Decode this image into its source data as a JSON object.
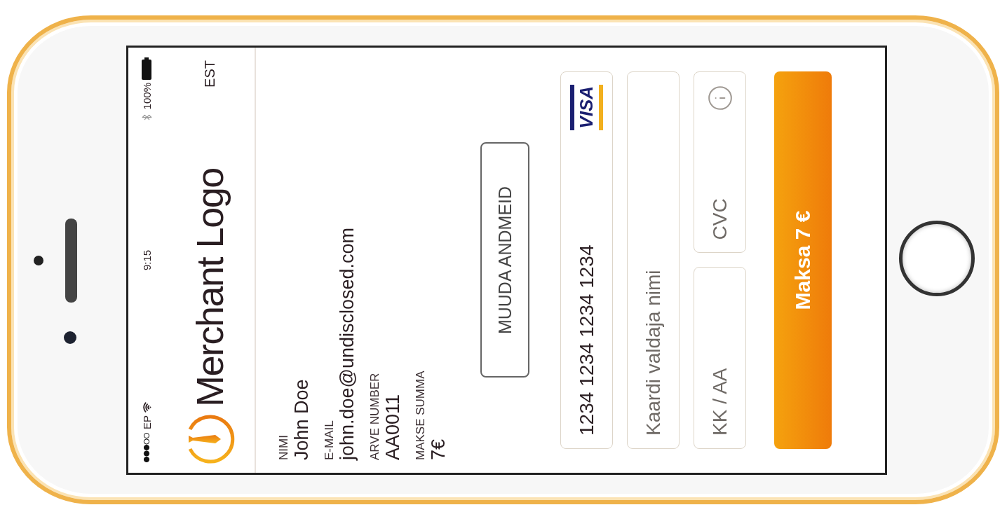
{
  "status_bar": {
    "carrier": "EP",
    "time": "9:15",
    "battery": "100%"
  },
  "header": {
    "logo_text": "Merchant Logo",
    "language": "EST"
  },
  "details": [
    {
      "label": "NIMI",
      "value": "John Doe"
    },
    {
      "label": "E-MAIL",
      "value": "john.doe@undisclosed.com"
    },
    {
      "label": "ARVE NUMBER",
      "value": "AA0011"
    },
    {
      "label": "MAKSE SUMMA",
      "value": "7€"
    }
  ],
  "edit_button": "MUUDA ANDMEID",
  "card_form": {
    "card_number": {
      "value": "1234 1234 1234 1234",
      "brand": "VISA"
    },
    "holder_name": {
      "placeholder": "Kaardi valdaja nimi"
    },
    "expiry": {
      "placeholder": "KK / AA"
    },
    "cvc": {
      "placeholder": "CVC"
    }
  },
  "pay_button": "Maksa 7 €"
}
